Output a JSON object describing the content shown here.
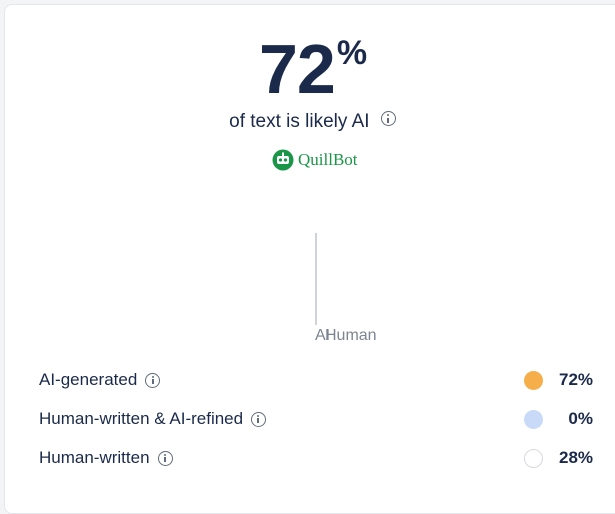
{
  "summary": {
    "score_value": "72",
    "score_unit": "%",
    "subtitle": "of text is likely AI"
  },
  "brand": {
    "name": "QuillBot",
    "color": "#1a9648"
  },
  "distribution": {
    "labels": [
      "AI",
      "Human"
    ]
  },
  "legend": [
    {
      "label": "AI-generated",
      "percent": "72%",
      "value": 72,
      "color": "#f6ae4b"
    },
    {
      "label": "Human-written & AI-refined",
      "percent": "0%",
      "value": 0,
      "color": "#c8daf8"
    },
    {
      "label": "Human-written",
      "percent": "28%",
      "value": 28,
      "color": "#ffffff"
    }
  ]
}
